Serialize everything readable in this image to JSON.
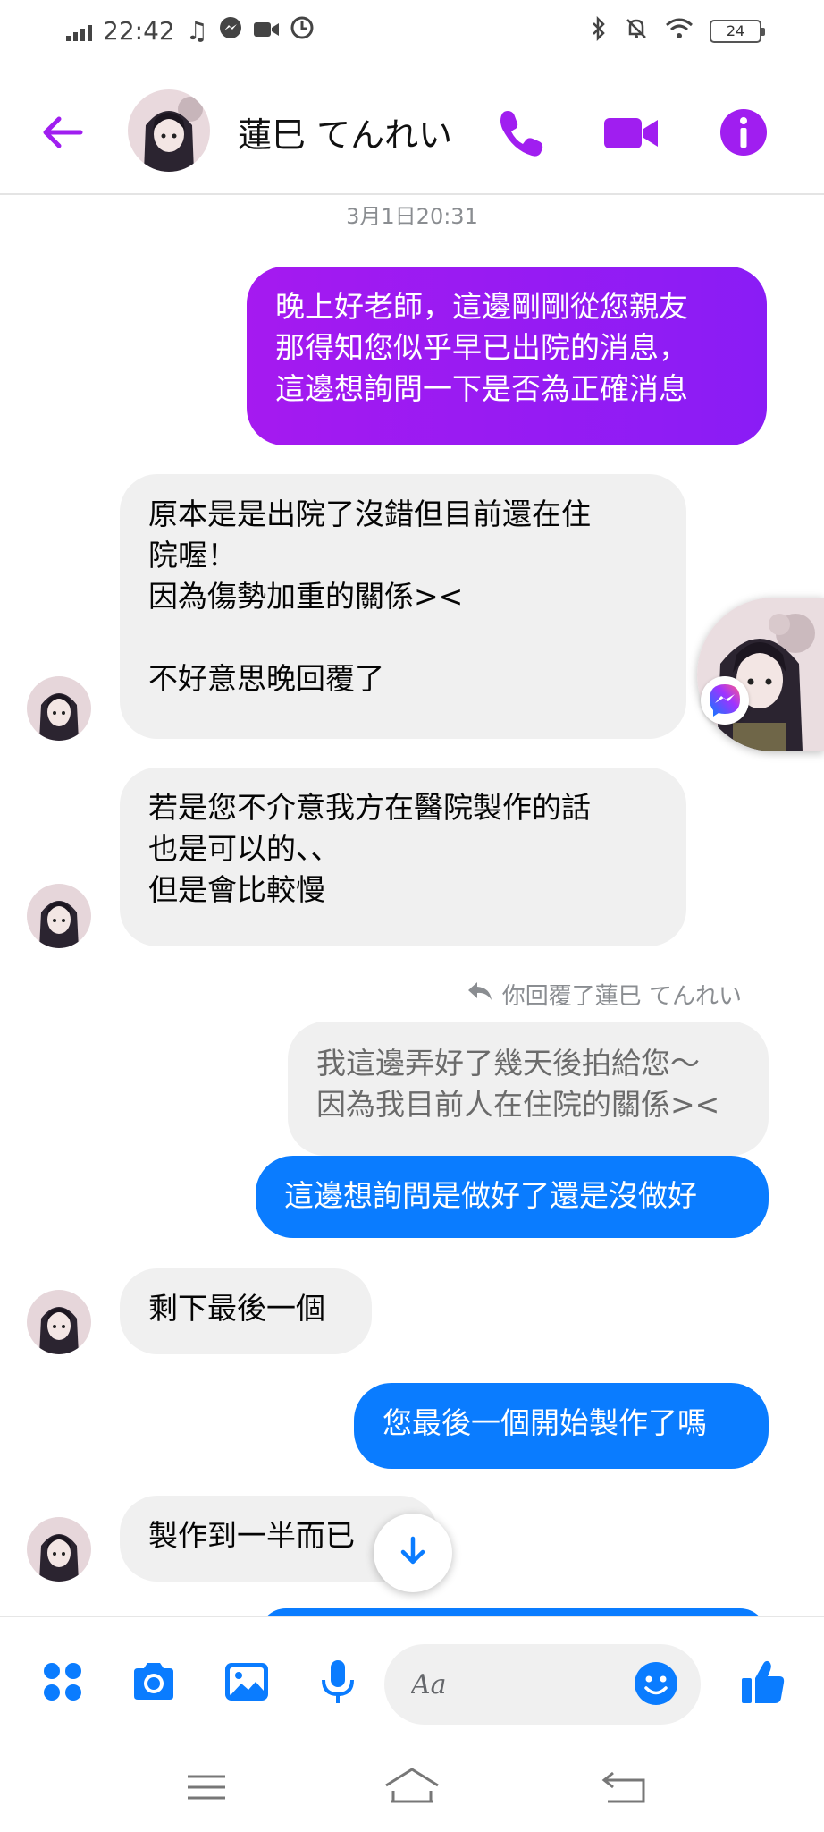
{
  "status_bar": {
    "time": "22:42",
    "battery": "24"
  },
  "header": {
    "contact_name": "蓮巳 てんれい"
  },
  "chat": {
    "timestamp": "3月1日20:31",
    "reply_note": "你回覆了蓮巳 てんれい",
    "messages": [
      {
        "direction": "out",
        "style": "purple",
        "text": "晚上好老師，這邊剛剛從您親友\n那得知您似乎早已出院的消息，\n這邊想詢問一下是否為正確消息"
      },
      {
        "direction": "in",
        "text": "原本是是出院了沒錯但目前還在住\n院喔！\n因為傷勢加重的關係><\n\n不好意思晚回覆了"
      },
      {
        "direction": "in",
        "text": "若是您不介意我方在醫院製作的話\n也是可以的、、\n但是會比較慢"
      },
      {
        "direction": "quoted",
        "text": "我這邊弄好了幾天後拍給您～\n因為我目前人在住院的關係><"
      },
      {
        "direction": "out",
        "style": "blue",
        "text": "這邊想詢問是做好了還是沒做好"
      },
      {
        "direction": "in",
        "text": "剩下最後一個"
      },
      {
        "direction": "out",
        "style": "blue",
        "text": "您最後一個開始製作了嗎"
      },
      {
        "direction": "in",
        "text": "製作到一半而已"
      }
    ]
  },
  "composer": {
    "placeholder": "Aa"
  },
  "colors": {
    "accent_purple": "#a01ef0",
    "messenger_blue": "#0a7cff",
    "incoming_bg": "#f0f0f0"
  },
  "icons": [
    "back-arrow-icon",
    "phone-icon",
    "video-icon",
    "info-icon",
    "apps-icon",
    "camera-icon",
    "gallery-icon",
    "microphone-icon",
    "emoji-icon",
    "thumbs-up-icon",
    "scroll-down-icon"
  ]
}
